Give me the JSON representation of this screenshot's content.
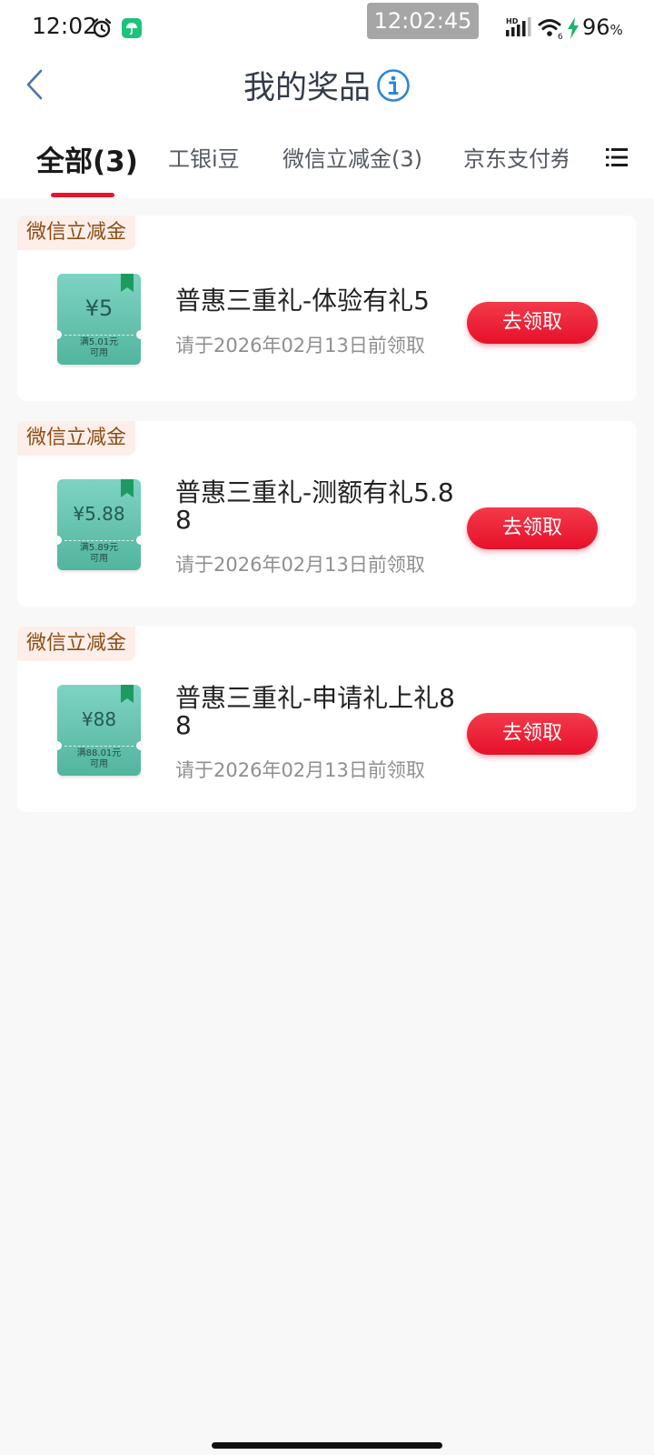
{
  "status_bar": {
    "time": "12:02",
    "clock_overlay": "12:02:45",
    "battery_value": "96",
    "battery_unit": "%"
  },
  "header": {
    "title": "我的奖品",
    "back_icon": "chevron-left-icon",
    "info_icon": "info-icon"
  },
  "tabs": [
    {
      "label": "全部(3)",
      "active": true
    },
    {
      "label": "工银i豆"
    },
    {
      "label": "微信立减金(3)"
    },
    {
      "label": "京东支付券"
    }
  ],
  "tab_menu_icon": "list-menu-icon",
  "prizes": [
    {
      "tag": "微信立减金",
      "amount": "¥5",
      "condition_line1": "满5.01元",
      "condition_line2": "可用",
      "name": "普惠三重礼-体验有礼5",
      "deadline": "请于2026年02月13日前领取",
      "button": "去领取"
    },
    {
      "tag": "微信立减金",
      "amount": "¥5.88",
      "condition_line1": "满5.89元",
      "condition_line2": "可用",
      "name": "普惠三重礼-测额有礼5.88",
      "deadline": "请于2026年02月13日前领取",
      "button": "去领取"
    },
    {
      "tag": "微信立减金",
      "amount": "¥88",
      "condition_line1": "满88.01元",
      "condition_line2": "可用",
      "name": "普惠三重礼-申请礼上礼88",
      "deadline": "请于2026年02月13日前领取",
      "button": "去领取"
    }
  ],
  "colors": {
    "accent_red": "#e6162d",
    "tag_bg": "#fdeee9",
    "tag_text": "#8a4e16",
    "coupon_green": "#52b59d",
    "page_bg": "#f8f8f8"
  }
}
